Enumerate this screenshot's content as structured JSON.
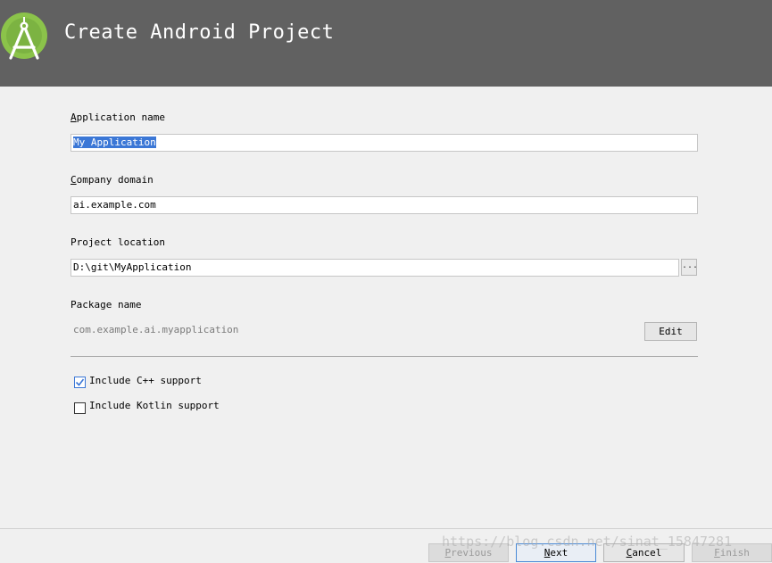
{
  "header": {
    "title": "Create Android Project",
    "logo_icon": "android-studio-logo-icon"
  },
  "form": {
    "app_name_label": "Application name",
    "app_name_value": "My Application",
    "company_domain_label": "Company domain",
    "company_domain_value": "ai.example.com",
    "project_location_label": "Project location",
    "project_location_value": "D:\\git\\MyApplication",
    "browse_label": "...",
    "package_name_label": "Package name",
    "package_name_value": "com.example.ai.myapplication",
    "edit_label": "Edit"
  },
  "options": {
    "cpp_label": "Include C++ support",
    "cpp_checked": true,
    "kotlin_label": "Include Kotlin support",
    "kotlin_checked": false
  },
  "footer": {
    "previous_label": "Previous",
    "next_label": "Next",
    "cancel_label": "Cancel",
    "finish_label": "Finish"
  },
  "watermark": "https://blog.csdn.net/sinat_15847281",
  "colors": {
    "header_bg": "#616161",
    "selection": "#3b77d6",
    "logo_green": "#8bc34a"
  }
}
